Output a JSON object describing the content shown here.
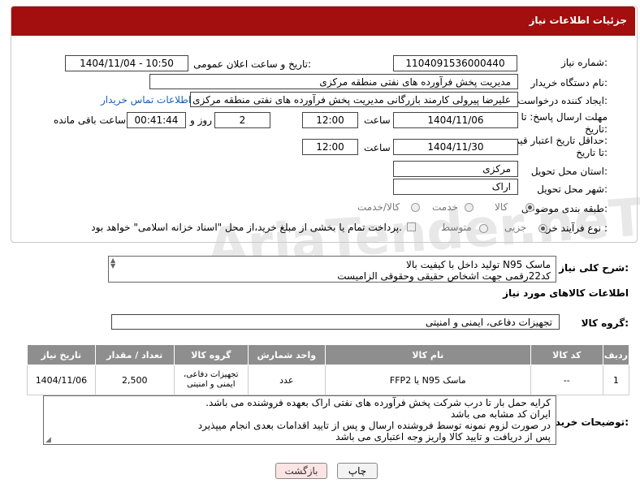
{
  "header": {
    "title": "جزئیات اطلاعات نیاز"
  },
  "form": {
    "need_number_label": "شماره نیاز:",
    "need_number": "1104091536000440",
    "announce_label": "تاریخ و ساعت اعلان عمومی:",
    "announce_value": "1404/11/04 - 10:50",
    "buyer_org_label": "نام دستگاه خریدار:",
    "buyer_org": "مدیریت پخش فرآورده های نفتی منطقه مرکزی",
    "creator_label": "ایجاد کننده درخواست:",
    "creator": "علیرضا پیرولی کارمند بازرگانی مدیریت پخش فرآورده های نفتی منطقه مرکزی",
    "contact_link": "اطلاعات تماس خریدار",
    "reply_deadline_label_1": "مهلت ارسال پاسخ: تا",
    "reply_deadline_label_2": "تاریخ:",
    "reply_date": "1404/11/06",
    "time_label": "ساعت",
    "reply_time": "12:00",
    "days_value": "2",
    "days_label": "روز و",
    "remaining_value": "00:41:44",
    "remaining_label": "ساعت باقی مانده",
    "price_deadline_label_1": "حداقل تاریخ اعتبار قیمت:",
    "price_deadline_label_2": "تا تاریخ:",
    "price_date": "1404/11/30",
    "price_time": "12:00",
    "province_label": "استان محل تحویل:",
    "province": "مرکزی",
    "city_label": "شهر محل تحویل:",
    "city": "اراک",
    "category_label": "طبقه بندی موضوعی:",
    "category_options": [
      "کالا",
      "خدمت",
      "کالا/خدمت"
    ],
    "process_label": "نوع فرآیند خرید :",
    "process_options": [
      "جزیی",
      "متوسط"
    ],
    "payment_note": "پرداخت تمام یا بخشی از مبلغ خرید،از محل \"اسناد خزانه اسلامی\" خواهد بود."
  },
  "summary": {
    "label": "شرح کلی نیاز:",
    "lines": [
      "ماسک N95 تولید داخل با کیفیت بالا",
      "کد22رقمی  جهت اشخاص حقیقی وحقوقی الزامیست"
    ]
  },
  "goods": {
    "section_title": "اطلاعات کالاهای مورد نیاز",
    "group_label": "گروه کالا:",
    "group_value": "تجهیزات دفاعی، ایمنی و امنیتی",
    "columns": [
      "ردیف",
      "کد کالا",
      "نام کالا",
      "واحد شمارش",
      "گروه کالا",
      "تعداد / مقدار",
      "تاریخ نیاز"
    ],
    "rows": [
      {
        "row": "1",
        "code": "--",
        "name": "ماسک N95 یا FFP2",
        "unit": "عدد",
        "group": "تجهیزات دفاعی، ایمنی و امنیتی",
        "qty": "2,500",
        "date": "1404/11/06"
      }
    ]
  },
  "buyer_notes": {
    "label": "توضیحات خریدار:",
    "lines": [
      "کرایه حمل بار تا درب شرکت  پخش فرآورده های نفتی اراک بعهده فروشنده می باشد.",
      "ایران کد مشابه می باشد",
      "در صورت لزوم نمونه توسط فروشنده ارسال و پس از تایید اقدامات بعدی انجام میپذیرد",
      "پس از دریافت و تایید کالا واریز وجه اعتباری می باشد"
    ]
  },
  "buttons": {
    "print": "چاپ",
    "back": "بازگشت"
  },
  "watermark": "AriaTender.neT"
}
